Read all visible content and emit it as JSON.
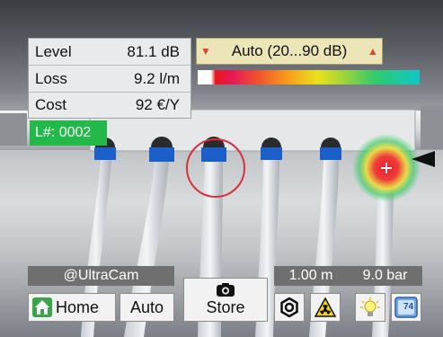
{
  "measurements": [
    {
      "label": "Level",
      "value": "81.1 dB"
    },
    {
      "label": "Loss",
      "value": "9.2 l/m"
    },
    {
      "label": "Cost",
      "value": "92 €/Y"
    }
  ],
  "range": {
    "label": "Auto (20...90 dB)"
  },
  "leak_id": "L#: 0002",
  "brand": "@UltraCam",
  "params": {
    "distance": "1.00 m",
    "pressure": "9.0 bar"
  },
  "buttons": {
    "home": "Home",
    "auto": "Auto",
    "store": "Store",
    "thermo": "74"
  },
  "icons": [
    "home-icon",
    "camera-icon",
    "gear-icon",
    "radiation-warning-icon",
    "light-bulb-icon",
    "thermometer-icon"
  ],
  "colors": {
    "leak_badge": "#23b84a",
    "range_bg": "#ece5b8",
    "arrow": "#e0452c",
    "target": "#e8161e"
  }
}
